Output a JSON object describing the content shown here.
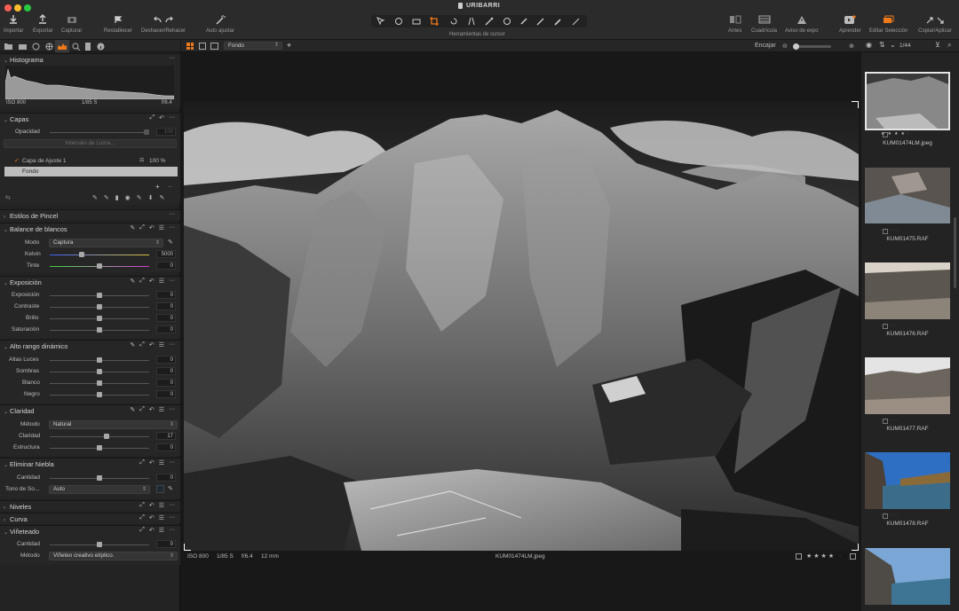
{
  "app": {
    "title": "URIBARRI"
  },
  "toolbar": {
    "import": "Importar",
    "export": "Exportar",
    "capture": "Capturar",
    "reset": "Restablecer",
    "undo_redo": "Deshacer/Rehacer",
    "auto_adjust": "Auto ajustar",
    "cursor_tools": "Herramientas de cursor",
    "before": "Antes",
    "grid": "Cuadrícula",
    "exposure_warning": "Aviso de expo",
    "learn": "Aprender",
    "edit_selection": "Editar Selección",
    "copy_apply": "Copiar/Aplicar"
  },
  "histogram": {
    "title": "Histograma",
    "iso": "ISO 800",
    "shutter": "1/85 S",
    "aperture": "f/6.4"
  },
  "layers": {
    "title": "Capas",
    "opacity_label": "Opacidad",
    "opacity_value": "100",
    "luma_button": "Intervalo de Luma...",
    "items": [
      {
        "name": "Capa de Ajuste 1",
        "value": "100 %"
      },
      {
        "name": "Fondo"
      }
    ]
  },
  "brush_styles": {
    "title": "Estilos de Pincel"
  },
  "white_balance": {
    "title": "Balance de blancos",
    "mode_label": "Modo",
    "mode_value": "Captura",
    "kelvin_label": "Kelvin",
    "kelvin_value": "5000",
    "tint_label": "Tinte",
    "tint_value": "0"
  },
  "exposure": {
    "title": "Exposición",
    "sliders": [
      {
        "label": "Exposición",
        "value": "0"
      },
      {
        "label": "Contraste",
        "value": "0"
      },
      {
        "label": "Brillo",
        "value": "0"
      },
      {
        "label": "Saturación",
        "value": "0"
      }
    ]
  },
  "hdr": {
    "title": "Alto rango dinámico",
    "sliders": [
      {
        "label": "Altas Luces",
        "value": "0"
      },
      {
        "label": "Sombras",
        "value": "0"
      },
      {
        "label": "Blanco",
        "value": "0"
      },
      {
        "label": "Negro",
        "value": "0"
      }
    ]
  },
  "clarity": {
    "title": "Claridad",
    "method_label": "Método",
    "method_value": "Natural",
    "clarity_label": "Claridad",
    "clarity_value": "17",
    "structure_label": "Estructura",
    "structure_value": "0"
  },
  "dehaze": {
    "title": "Eliminar Niebla",
    "amount_label": "Cantidad",
    "amount_value": "0",
    "tone_label": "Tono de So...",
    "tone_value": "Auto"
  },
  "levels": {
    "title": "Niveles"
  },
  "curve": {
    "title": "Curva"
  },
  "vignette": {
    "title": "Viñeteado",
    "amount_label": "Cantidad",
    "amount_value": "0",
    "method_label": "Método",
    "method_value": "Viñeteo creativo elíptico."
  },
  "viewer": {
    "layer_select": "Fondo",
    "fit": "Encajar",
    "iso": "ISO 800",
    "shutter": "1/85 S",
    "aperture": "f/6.4",
    "focal": "12 mm",
    "filename": "KUM01474LM.jpeg"
  },
  "browser": {
    "counter": "1/44",
    "thumbs": [
      {
        "name": "KUM01474LM.jpeg"
      },
      {
        "name": "KUM01475.RAF"
      },
      {
        "name": "KUM01476.RAF"
      },
      {
        "name": "KUM01477.RAF"
      },
      {
        "name": "KUM01478.RAF"
      },
      {
        "name": ""
      }
    ]
  },
  "colors": {
    "accent": "#f07a1a",
    "panel": "#262626",
    "viewer_bg": "#181818"
  }
}
